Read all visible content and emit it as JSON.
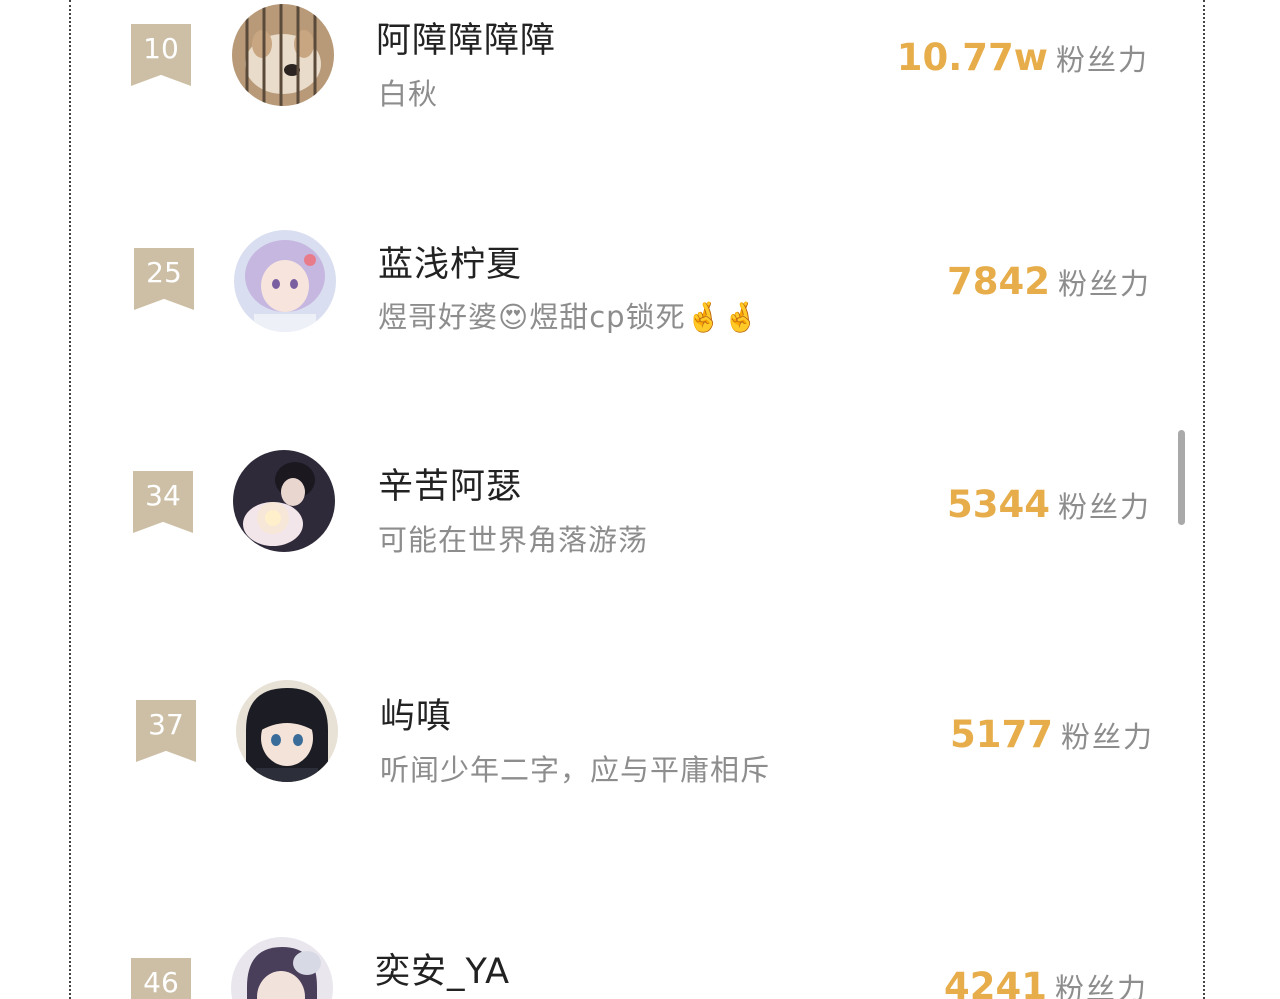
{
  "list": {
    "fans_unit": "粉丝力",
    "rows": [
      {
        "rank": "10",
        "name": "阿障障障障",
        "bio": "白秋",
        "fans": "10.77w",
        "avatar_icon": "dog-avatar"
      },
      {
        "rank": "25",
        "name": "蓝浅柠夏",
        "bio": "煜哥好婆😍煜甜cp锁死🤞🤞",
        "fans": "7842",
        "avatar_icon": "anime-girl-avatar"
      },
      {
        "rank": "34",
        "name": "辛苦阿瑟",
        "bio": "可能在世界角落游荡",
        "fans": "5344",
        "avatar_icon": "anime-couple-avatar"
      },
      {
        "rank": "37",
        "name": "屿嗔",
        "bio": "听闻少年二字，应与平庸相斥",
        "fans": "5177",
        "avatar_icon": "anime-boy-avatar"
      },
      {
        "rank": "46",
        "name": "奕安_YA",
        "bio": "",
        "fans": "4241",
        "avatar_icon": "anime-boy-avatar"
      }
    ]
  },
  "colors": {
    "rank_badge": "#cdbfa6",
    "fans_value": "#e6ad4a",
    "muted_text": "#8d8d8d",
    "name_text": "#222222"
  }
}
